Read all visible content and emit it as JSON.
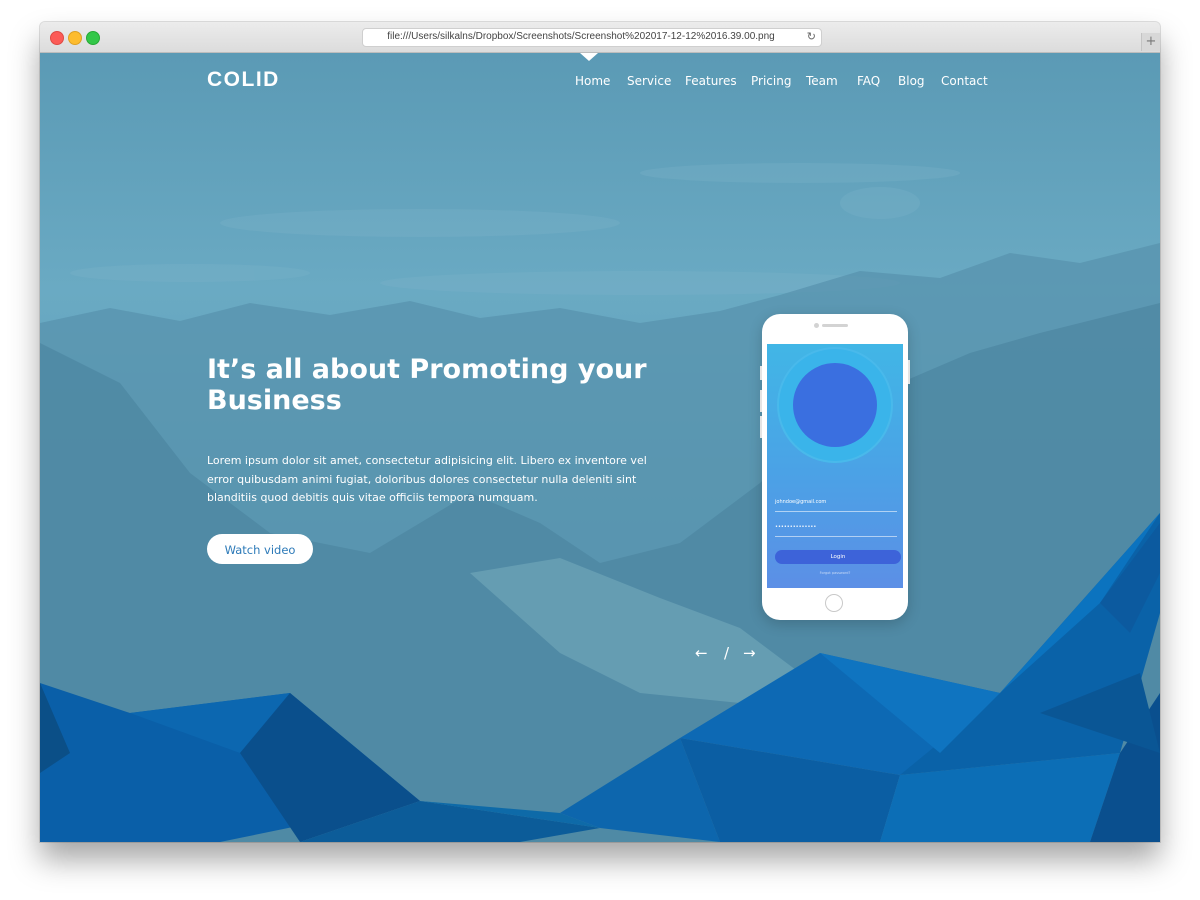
{
  "browser": {
    "url": "file:///Users/silkalns/Dropbox/Screenshots/Screenshot%202017-12-12%2016.39.00.png",
    "reload_glyph": "↻",
    "new_tab_glyph": "+"
  },
  "site": {
    "logo": "COLID",
    "nav": [
      "Home",
      "Service",
      "Features",
      "Pricing",
      "Team",
      "FAQ",
      "Blog",
      "Contact"
    ],
    "active_nav": "Home"
  },
  "hero": {
    "headline": "It’s all about Promoting your Business",
    "body": "Lorem ipsum dolor sit amet, consectetur adipisicing elit. Libero ex inventore vel error quibusdam animi fugiat, doloribus dolores consectetur nulla deleniti sint blanditiis quod debitis quis vitae officiis tempora numquam.",
    "cta_label": "Watch video"
  },
  "phone": {
    "email": "johndoe@gmail.com",
    "password_mask": "••••••••••••••",
    "login_label": "Login",
    "forgot_label": "Forgot password?"
  },
  "slider": {
    "prev_glyph": "←",
    "separator": "/",
    "next_glyph": "→"
  },
  "colors": {
    "overlay": "#5b9ab5",
    "polygon_blue": "#0a5fa8",
    "button_text": "#2d7ab8"
  }
}
